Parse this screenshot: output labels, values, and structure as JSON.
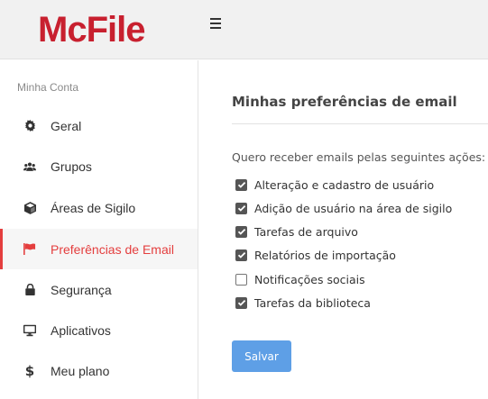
{
  "header": {
    "logo_text": "McFile",
    "menu_icon": "hamburger-icon"
  },
  "sidebar": {
    "title": "Minha Conta",
    "items": [
      {
        "label": "Geral",
        "icon": "gear-icon"
      },
      {
        "label": "Grupos",
        "icon": "users-icon"
      },
      {
        "label": "Áreas de Sigilo",
        "icon": "cube-icon"
      },
      {
        "label": "Preferências de Email",
        "icon": "flag-icon",
        "active": true
      },
      {
        "label": "Segurança",
        "icon": "lock-icon"
      },
      {
        "label": "Aplicativos",
        "icon": "monitor-icon"
      },
      {
        "label": "Meu plano",
        "icon": "dollar-icon"
      }
    ]
  },
  "main": {
    "title": "Minhas preferências de email",
    "intro": "Quero receber emails pelas seguintes ações:",
    "options": [
      {
        "label": "Alteração e cadastro de usuário",
        "checked": true
      },
      {
        "label": "Adição de usuário na área de sigilo",
        "checked": true
      },
      {
        "label": "Tarefas de arquivo",
        "checked": true
      },
      {
        "label": "Relatórios de importação",
        "checked": true
      },
      {
        "label": "Notificações sociais",
        "checked": false
      },
      {
        "label": "Tarefas da biblioteca",
        "checked": true
      }
    ],
    "save_label": "Salvar"
  },
  "colors": {
    "brand": "#c8202f",
    "active": "#e43e3e",
    "button": "#5e9fe6"
  }
}
